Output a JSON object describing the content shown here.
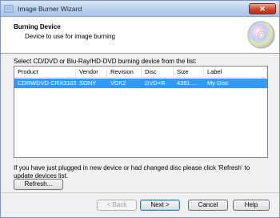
{
  "window": {
    "title": "Image Burner Wizard",
    "close_label": "✕"
  },
  "header": {
    "title": "Burning Device",
    "subtitle": "Device to use for image burning"
  },
  "device_list": {
    "label": "Select CD/DVD or Blu-Ray/HD-DVD burning device from the list:",
    "columns": [
      "Product",
      "Vendor",
      "Revision",
      "Disc",
      "Size",
      "Label"
    ],
    "rows": [
      [
        "CDRWDVD CRX310S",
        "SONY",
        "VDK2",
        "DVD+R",
        "4391....",
        "My Disc"
      ]
    ]
  },
  "info_text": "If you have just plugged in new device or had changed disc please click 'Refresh' to update devices list.",
  "buttons": {
    "refresh": "Refresh...",
    "back": "< Back",
    "next": "Next >",
    "cancel": "Cancel",
    "help": "Help"
  },
  "colors": {
    "selection": "#3399ff",
    "title_bar": "#bcd2ee",
    "close": "#c9472a"
  }
}
